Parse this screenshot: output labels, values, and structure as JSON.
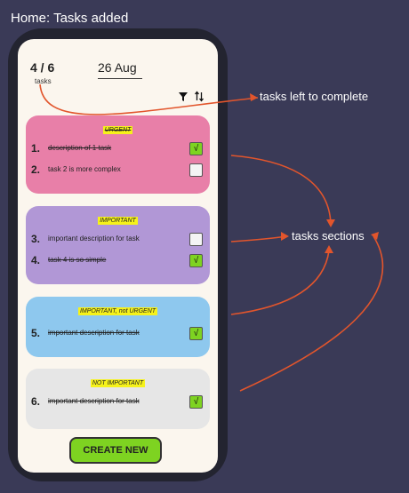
{
  "page_title": "Home: Tasks added",
  "header": {
    "count": "4 / 6",
    "count_label": "tasks",
    "date": "26 Aug"
  },
  "sections": [
    {
      "label": "URGENT",
      "color": "#e87fa8",
      "tasks": [
        {
          "number": "1.",
          "description": "description of 1 task",
          "done": true,
          "check": "√"
        },
        {
          "number": "2.",
          "description": "task 2 is more complex",
          "done": false,
          "check": ""
        }
      ]
    },
    {
      "label": "IMPORTANT",
      "color": "#b197d6",
      "tasks": [
        {
          "number": "3.",
          "description": "important description for task",
          "done": false,
          "check": ""
        },
        {
          "number": "4.",
          "description": "task 4 is so simple",
          "done": true,
          "check": "√"
        }
      ]
    },
    {
      "label": "IMPORTANT, not URGENT",
      "color": "#8ec8ee",
      "tasks": [
        {
          "number": "5.",
          "description": "important description for task",
          "done": true,
          "check": "√"
        }
      ]
    },
    {
      "label": "NOT IMPORTANT",
      "color": "#e6e6e6",
      "tasks": [
        {
          "number": "6.",
          "description": "important description for task",
          "done": true,
          "check": "√"
        }
      ]
    }
  ],
  "create_button": "CREATE NEW",
  "annotations": {
    "tasks_left": "tasks left to complete",
    "tasks_sections": "tasks sections"
  },
  "icons": {
    "filter": "filter-icon",
    "sort": "sort-icon"
  }
}
